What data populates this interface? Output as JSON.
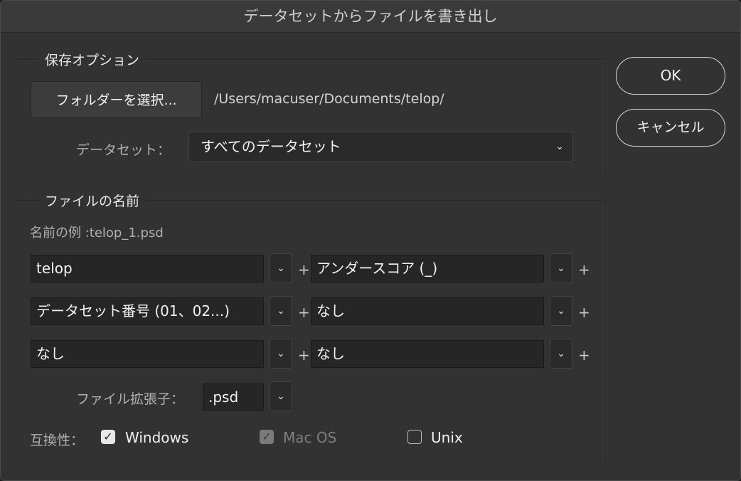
{
  "window": {
    "title": "データセットからファイルを書き出し"
  },
  "save_options": {
    "legend": "保存オプション",
    "folder_button": "フォルダーを選択...",
    "folder_path": "/Users/macuser/Documents/telop/",
    "dataset_label": "データセット：",
    "dataset_value": "すべてのデータセット"
  },
  "file_name": {
    "legend": "ファイルの名前",
    "example": "名前の例 :telop_1.psd",
    "rows": [
      {
        "left": "telop",
        "right": "アンダースコア (_)"
      },
      {
        "left": "データセット番号 (01、02...)",
        "right": "なし"
      },
      {
        "left": "なし",
        "right": "なし"
      }
    ],
    "plus": "+",
    "extension_label": "ファイル拡張子：",
    "extension_value": ".psd"
  },
  "compatibility": {
    "label": "互換性：",
    "windows": {
      "label": "Windows",
      "checked": true
    },
    "macos": {
      "label": "Mac OS",
      "checked": true,
      "disabled": true
    },
    "unix": {
      "label": "Unix",
      "checked": false
    }
  },
  "buttons": {
    "ok": "OK",
    "cancel": "キャンセル"
  },
  "icons": {
    "chevron": "chevron-down-icon",
    "check": "checkmark-icon"
  }
}
